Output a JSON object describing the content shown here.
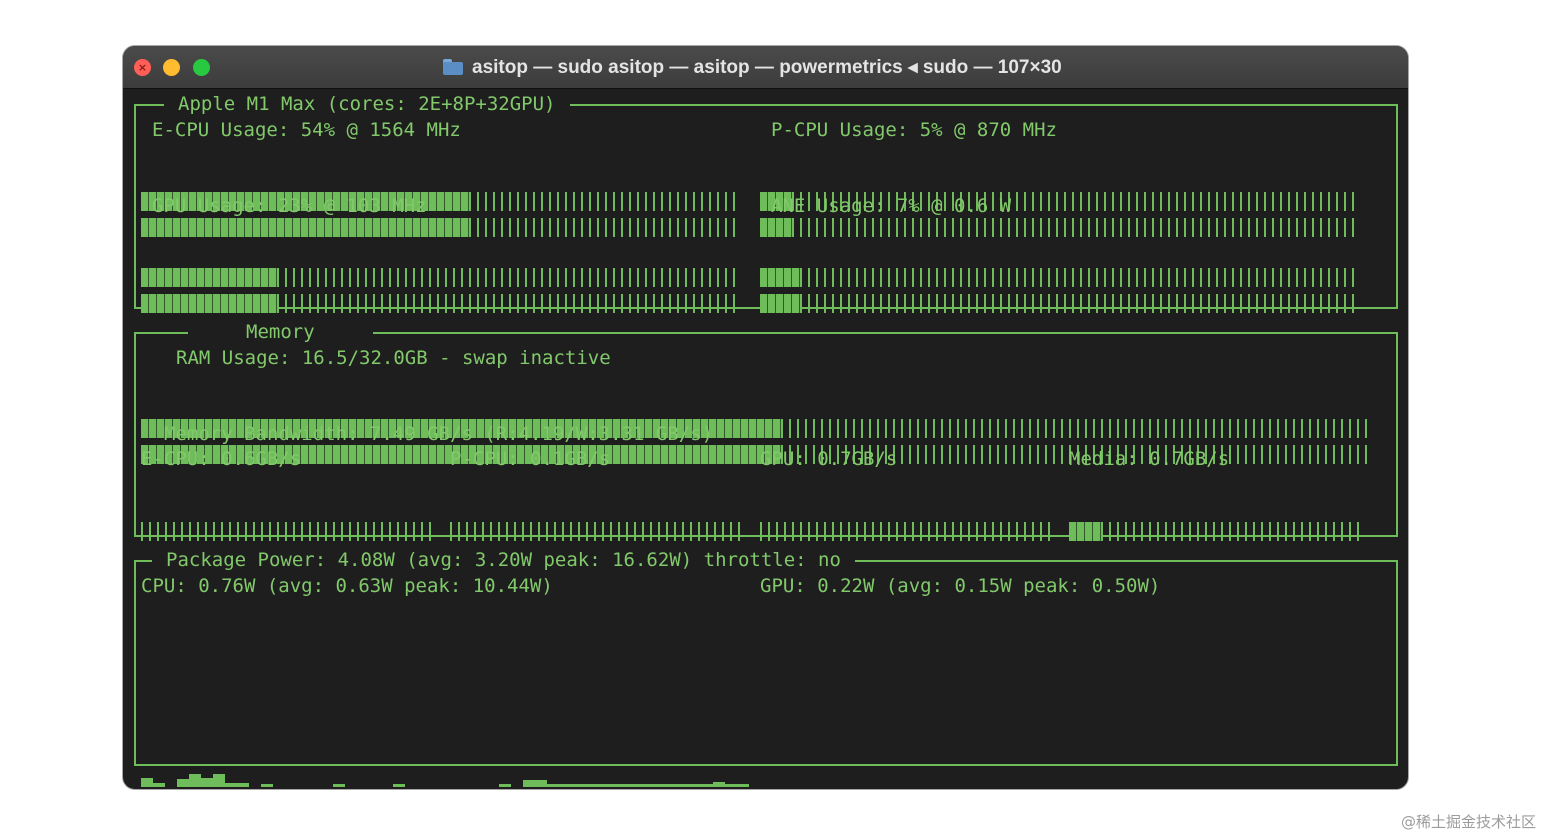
{
  "window": {
    "title": "asitop — sudo asitop — asitop — powermetrics ◂ sudo — 107×30"
  },
  "cpu_panel": {
    "title": "Apple M1 Max (cores: 2E+8P+32GPU)",
    "ecpu": {
      "label": "E-CPU Usage: 54% @ 1564 MHz",
      "percent": 54
    },
    "pcpu": {
      "label": "P-CPU Usage: 5% @ 870 MHz",
      "percent": 5
    },
    "gpu": {
      "label": "GPU Usage: 23% @ 103 MHz",
      "percent": 23
    },
    "ane": {
      "label": "ANE Usage: 7% @ 0.6 W",
      "percent": 7
    }
  },
  "memory_panel": {
    "title": "Memory",
    "ram": {
      "label": "RAM Usage: 16.5/32.0GB - swap inactive",
      "percent": 52
    },
    "bandwidth_label": "Memory Bandwidth: 7.49 GB/s (R:4.19/W:3.31 GB/s)",
    "ecpu_bw": {
      "label": "E-CPU: 0.6GB/s",
      "percent": 0
    },
    "pcpu_bw": {
      "label": "P-CPU: 0.1GB/s",
      "percent": 0
    },
    "gpu_bw": {
      "label": "GPU: 0.7GB/s",
      "percent": 0
    },
    "media_bw": {
      "label": "Media: 0.7GB/s",
      "percent": 10
    }
  },
  "power_panel": {
    "title": "Package Power: 4.08W (avg: 3.20W peak: 16.62W) throttle: no",
    "cpu_label": "CPU: 0.76W (avg: 0.63W peak: 10.44W)",
    "gpu_label": "GPU: 0.22W (avg: 0.15W peak: 0.50W)"
  },
  "watermark": "@稀土掘金技术社区",
  "colors": {
    "terminal_green": "#6fbd5a",
    "terminal_bg": "#1e1e1e"
  }
}
